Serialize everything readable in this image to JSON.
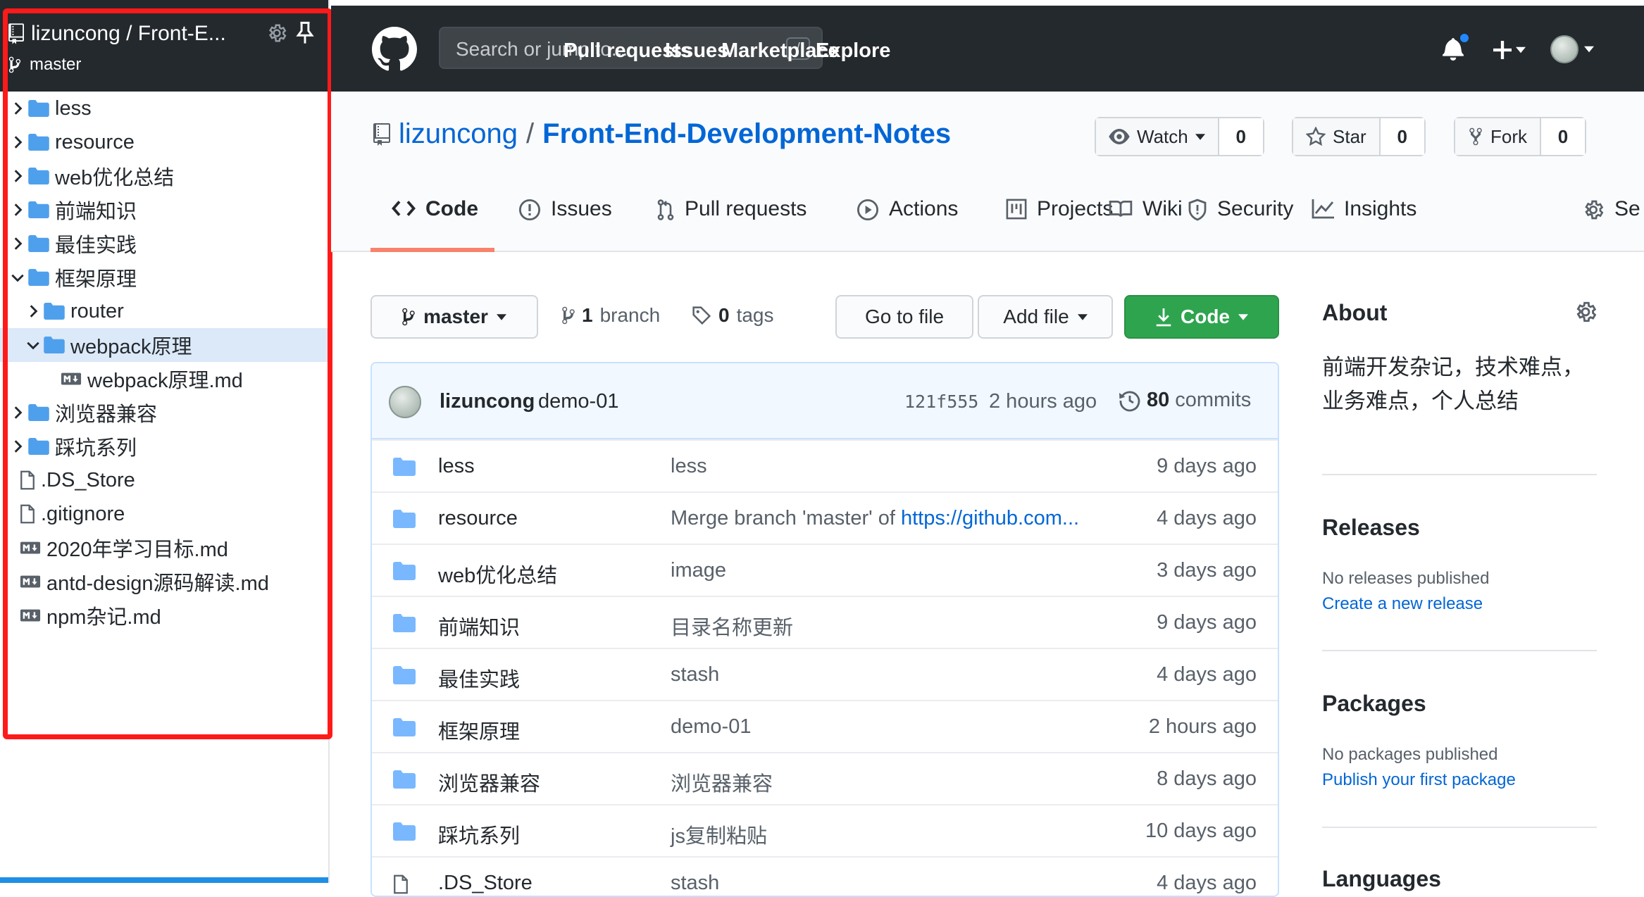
{
  "sidebar": {
    "title": "lizuncong / Front-E...",
    "branch": "master",
    "tree": [
      {
        "label": "less",
        "kind": "folder",
        "depth": 0,
        "expanded": false
      },
      {
        "label": "resource",
        "kind": "folder",
        "depth": 0,
        "expanded": false
      },
      {
        "label": "web优化总结",
        "kind": "folder",
        "depth": 0,
        "expanded": false
      },
      {
        "label": "前端知识",
        "kind": "folder",
        "depth": 0,
        "expanded": false
      },
      {
        "label": "最佳实践",
        "kind": "folder",
        "depth": 0,
        "expanded": false
      },
      {
        "label": "框架原理",
        "kind": "folder",
        "depth": 0,
        "expanded": true
      },
      {
        "label": "router",
        "kind": "folder",
        "depth": 1,
        "expanded": false
      },
      {
        "label": "webpack原理",
        "kind": "folder",
        "depth": 1,
        "expanded": true,
        "selected": true
      },
      {
        "label": "webpack原理.md",
        "kind": "md",
        "depth": 2
      },
      {
        "label": "浏览器兼容",
        "kind": "folder",
        "depth": 0,
        "expanded": false
      },
      {
        "label": "踩坑系列",
        "kind": "folder",
        "depth": 0,
        "expanded": false
      },
      {
        "label": ".DS_Store",
        "kind": "file",
        "depth": 0
      },
      {
        "label": ".gitignore",
        "kind": "file",
        "depth": 0
      },
      {
        "label": "2020年学习目标.md",
        "kind": "md",
        "depth": 0
      },
      {
        "label": "antd-design源码解读.md",
        "kind": "md",
        "depth": 0
      },
      {
        "label": "npm杂记.md",
        "kind": "md",
        "depth": 0
      }
    ]
  },
  "header": {
    "search_placeholder": "Search or jump to...",
    "search_key": "/",
    "nav": [
      "Pull requests",
      "Issues",
      "Marketplace",
      "Explore"
    ]
  },
  "repo": {
    "owner": "lizuncong",
    "separator": "/",
    "name": "Front-End-Development-Notes",
    "watch_label": "Watch",
    "watch_count": "0",
    "star_label": "Star",
    "star_count": "0",
    "fork_label": "Fork",
    "fork_count": "0",
    "tabs": [
      "Code",
      "Issues",
      "Pull requests",
      "Actions",
      "Projects",
      "Wiki",
      "Security",
      "Insights",
      "Se"
    ]
  },
  "toolbar": {
    "branch": "master",
    "branch_count": "1",
    "branch_word": "branch",
    "tag_count": "0",
    "tag_word": "tags",
    "go_to_file": "Go to file",
    "add_file": "Add file",
    "code": "Code"
  },
  "commit": {
    "author": "lizuncong",
    "message": "demo-01",
    "sha": "121f555",
    "time": "2 hours ago",
    "count": "80",
    "count_word": "commits"
  },
  "files": [
    {
      "name": "less",
      "message": "less",
      "age": "9 days ago"
    },
    {
      "name": "resource",
      "message": "Merge branch 'master' of ",
      "link": "https://github.com...",
      "age": "4 days ago"
    },
    {
      "name": "web优化总结",
      "message": "image",
      "age": "3 days ago"
    },
    {
      "name": "前端知识",
      "message": "目录名称更新",
      "age": "9 days ago"
    },
    {
      "name": "最佳实践",
      "message": "stash",
      "age": "4 days ago"
    },
    {
      "name": "框架原理",
      "message": "demo-01",
      "age": "2 hours ago"
    },
    {
      "name": "浏览器兼容",
      "message": "浏览器兼容",
      "age": "8 days ago"
    },
    {
      "name": "踩坑系列",
      "message": "js复制粘贴",
      "age": "10 days ago"
    },
    {
      "name": ".DS_Store",
      "message": "stash",
      "age": "4 days ago"
    }
  ],
  "about": {
    "heading": "About",
    "description_line1": "前端开发杂记，技术难点，",
    "description_line2": "业务难点，个人总结",
    "releases_heading": "Releases",
    "releases_text": "No releases published",
    "releases_link": "Create a new release",
    "packages_heading": "Packages",
    "packages_text": "No packages published",
    "packages_link": "Publish your first package",
    "languages_heading": "Languages"
  },
  "colors": {
    "header_bg": "#24292e",
    "link": "#0366d6",
    "green_button": "#2ea44f",
    "tab_underline": "#f9826c",
    "folder": "#79b8ff",
    "highlight_box": "#ff1a1a"
  }
}
